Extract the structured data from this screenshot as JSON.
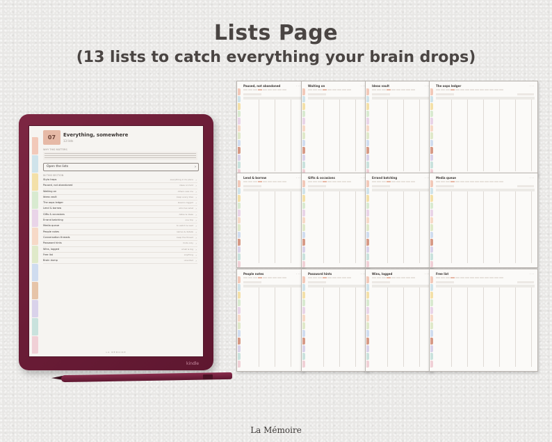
{
  "heading": {
    "title": "Lists Page",
    "subtitle": "(13 lists to catch everything your brain drops)"
  },
  "brand": "La Mémoire",
  "device": {
    "logo": "kindle",
    "screen": {
      "chip": "07",
      "title": "Everything, somewhere",
      "subtitle": "13 lists",
      "note_label": "WHY THIS MATTERS",
      "open_button": "Open the lists",
      "section_label": "IN THIS SECTION",
      "footer": "LA MÉMOIRE",
      "items": [
        {
          "label": "Stylo traps",
          "desc": "everything in its place"
        },
        {
          "label": "Paused, not abandoned",
          "desc": "ideas on hold"
        },
        {
          "label": "Waiting on",
          "desc": "others owe me"
        },
        {
          "label": "Ideas vault",
          "desc": "keep every idea"
        },
        {
          "label": "The oops ledger",
          "desc": "lessons logged"
        },
        {
          "label": "Lend & borrow",
          "desc": "who has what"
        },
        {
          "label": "Gifts & occasions",
          "desc": "dates & ideas"
        },
        {
          "label": "Errand batching",
          "desc": "one trip"
        },
        {
          "label": "Media queue",
          "desc": "to watch & read"
        },
        {
          "label": "People notes",
          "desc": "names & details"
        },
        {
          "label": "Conversation threads",
          "desc": "keep the thread"
        },
        {
          "label": "Password hints",
          "desc": "hints only"
        },
        {
          "label": "Wins, logged",
          "desc": "small & big"
        },
        {
          "label": "Free list",
          "desc": "anything"
        },
        {
          "label": "Brain dump",
          "desc": "unsorted"
        }
      ]
    }
  },
  "pages": [
    {
      "title": "Paused, not abandoned"
    },
    {
      "title": "Waiting on"
    },
    {
      "title": "Ideas vault"
    },
    {
      "title": "The oops ledger"
    },
    {
      "title": "Lend & borrow"
    },
    {
      "title": "Gifts & occasions"
    },
    {
      "title": "Errand batching"
    },
    {
      "title": "Media queue"
    },
    {
      "title": "People notes"
    },
    {
      "title": "Password hints"
    },
    {
      "title": "Wins, logged"
    },
    {
      "title": "Free list"
    }
  ],
  "colors": {
    "tabs": [
      "#f2c9b9",
      "#cfe3ea",
      "#f3e0a8",
      "#d8ead0",
      "#e9d4e8",
      "#f6d9c7",
      "#dfe9c9",
      "#cfdcef",
      "#e6c4a8",
      "#d9d2ea",
      "#c9e2dd",
      "#f0d0d6"
    ],
    "device": "#6a1c36",
    "chip": "#e6b9a6"
  }
}
